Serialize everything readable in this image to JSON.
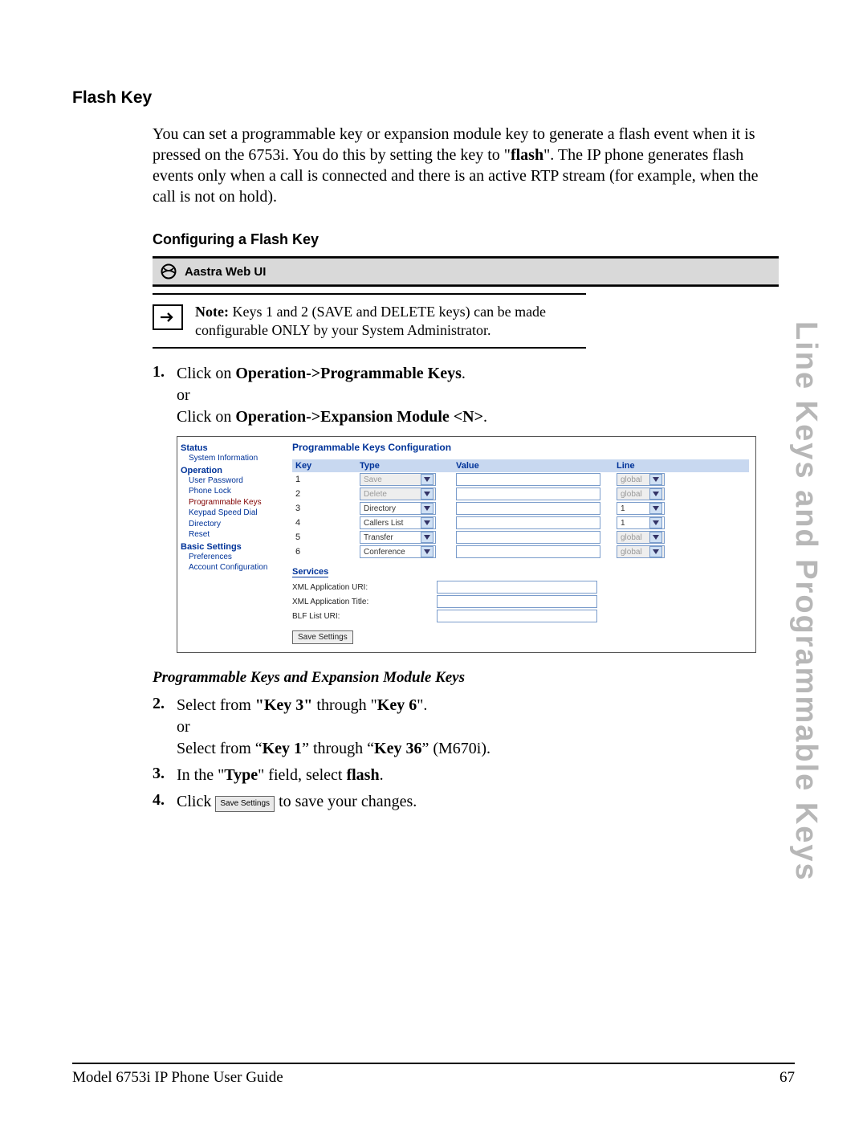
{
  "side_tab": "Line Keys and Programmable Keys",
  "section_title": "Flash Key",
  "intro_parts": {
    "p1": "You can set a programmable key or expansion module key to generate a flash event when it is pressed on the 6753i. You do this by setting the key to \"",
    "p1b": "flash",
    "p2": "\". The IP phone generates flash events only when a call is connected and there is an active RTP stream (for example, when the call is not on hold)."
  },
  "sub_title": "Configuring a Flash Key",
  "ui_bar_label": "Aastra Web UI",
  "note": {
    "label": "Note:",
    "text": " Keys 1 and 2 (SAVE and DELETE keys) can be made configurable ONLY by your System Administrator."
  },
  "steps": {
    "s1": {
      "num": "1.",
      "a": "Click on ",
      "a_b1": "Operation->Programmable Keys",
      "a2": ".",
      "or": "or",
      "b": "Click on ",
      "b_b1": "Operation->Expansion Module <N>",
      "b2": "."
    },
    "s2": {
      "num": "2.",
      "a": "Select from ",
      "a_b1": "\"Key 3\"",
      "mid": " through \"",
      "a_b2": "Key 6",
      "a2": "\".",
      "or": "or",
      "b": "Select from “",
      "b_b1": "Key 1",
      "b_mid": "” through “",
      "b_b2": "Key 36",
      "b2": "” (M670i)."
    },
    "s3": {
      "num": "3.",
      "a": "In the \"",
      "a_b1": "Type",
      "mid": "\" field, select ",
      "a_b2": "flash",
      "a2": "."
    },
    "s4": {
      "num": "4.",
      "a": "Click ",
      "btn": "Save Settings",
      "a2": " to save your changes."
    }
  },
  "italic_head": "Programmable Keys and Expansion Module Keys",
  "webui": {
    "nav": {
      "status": "Status",
      "status_items": [
        "System Information"
      ],
      "operation": "Operation",
      "operation_items": [
        "User Password",
        "Phone Lock",
        "Programmable Keys",
        "Keypad Speed Dial",
        "Directory",
        "Reset"
      ],
      "basic": "Basic Settings",
      "basic_items": [
        "Preferences",
        "Account Configuration"
      ]
    },
    "title": "Programmable Keys Configuration",
    "headers": {
      "key": "Key",
      "type": "Type",
      "value": "Value",
      "line": "Line"
    },
    "rows": [
      {
        "key": "1",
        "type": "Save",
        "type_disabled": true,
        "line": "global",
        "line_disabled": true
      },
      {
        "key": "2",
        "type": "Delete",
        "type_disabled": true,
        "line": "global",
        "line_disabled": true
      },
      {
        "key": "3",
        "type": "Directory",
        "type_disabled": false,
        "line": "1",
        "line_disabled": false
      },
      {
        "key": "4",
        "type": "Callers List",
        "type_disabled": false,
        "line": "1",
        "line_disabled": false
      },
      {
        "key": "5",
        "type": "Transfer",
        "type_disabled": false,
        "line": "global",
        "line_disabled": true
      },
      {
        "key": "6",
        "type": "Conference",
        "type_disabled": false,
        "line": "global",
        "line_disabled": true
      }
    ],
    "services_label": "Services",
    "services": [
      "XML Application URI:",
      "XML Application Title:",
      "BLF List URI:"
    ],
    "save_btn": "Save Settings"
  },
  "footer": {
    "left": "Model 6753i IP Phone User Guide",
    "right": "67"
  }
}
